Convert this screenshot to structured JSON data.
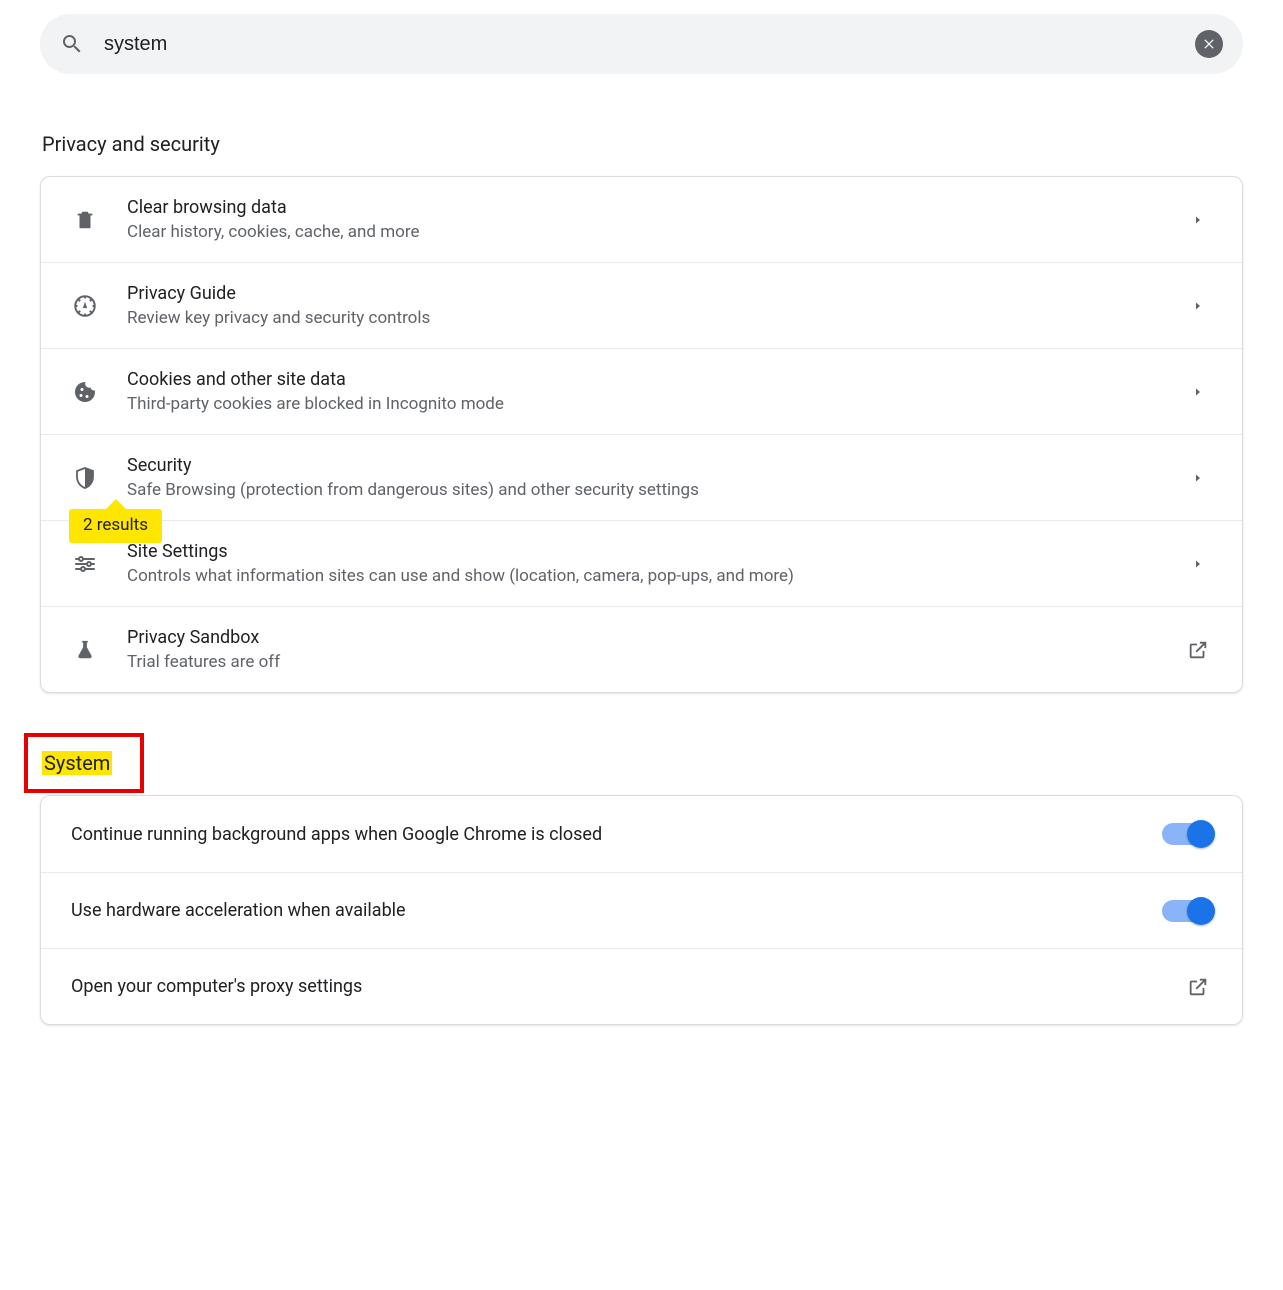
{
  "search": {
    "value": "system"
  },
  "privacy": {
    "header": "Privacy and security",
    "items": [
      {
        "title": "Clear browsing data",
        "sub": "Clear history, cookies, cache, and more"
      },
      {
        "title": "Privacy Guide",
        "sub": "Review key privacy and security controls"
      },
      {
        "title": "Cookies and other site data",
        "sub": "Third-party cookies are blocked in Incognito mode"
      },
      {
        "title": "Security",
        "sub": "Safe Browsing (protection from dangerous sites) and other security settings"
      },
      {
        "title": "Site Settings",
        "sub": "Controls what information sites can use and show (location, camera, pop-ups, and more)"
      },
      {
        "title": "Privacy Sandbox",
        "sub": "Trial features are off"
      }
    ],
    "results_bubble": "2 results"
  },
  "system": {
    "header": "System",
    "items": [
      {
        "title": "Continue running background apps when Google Chrome is closed"
      },
      {
        "title": "Use hardware acceleration when available"
      },
      {
        "title": "Open your computer's proxy settings"
      }
    ]
  }
}
